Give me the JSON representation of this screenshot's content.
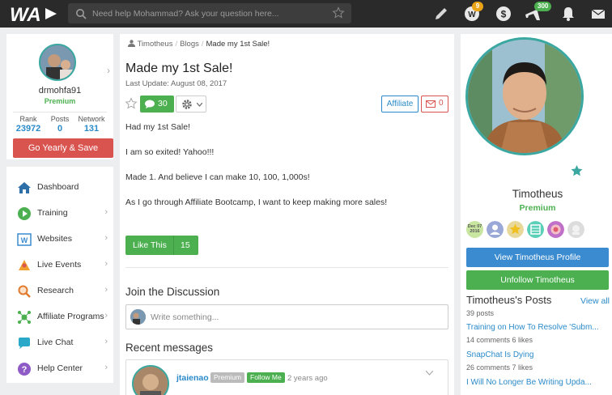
{
  "topbar": {
    "search_placeholder": "Need help Mohammad? Ask your question here...",
    "credits_badge": "9",
    "notifications_badge": "300"
  },
  "profile": {
    "username": "drmohfa91",
    "membership": "Premium",
    "stats": [
      {
        "label": "Rank",
        "value": "23972"
      },
      {
        "label": "Posts",
        "value": "0"
      },
      {
        "label": "Network",
        "value": "131"
      }
    ],
    "upgrade_label": "Go Yearly & Save"
  },
  "nav": {
    "items": [
      {
        "label": "Dashboard",
        "icon": "home-icon"
      },
      {
        "label": "Training",
        "icon": "play-icon"
      },
      {
        "label": "Websites",
        "icon": "websites-icon"
      },
      {
        "label": "Live Events",
        "icon": "live-events-icon"
      },
      {
        "label": "Research",
        "icon": "research-icon"
      },
      {
        "label": "Affiliate Programs",
        "icon": "affiliate-programs-icon"
      },
      {
        "label": "Live Chat",
        "icon": "chat-icon"
      },
      {
        "label": "Help Center",
        "icon": "help-icon"
      }
    ]
  },
  "post": {
    "breadcrumb": [
      "Timotheus",
      "Blogs",
      "Made my 1st Sale!"
    ],
    "title": "Made my 1st Sale!",
    "last_update": "Last Update: August 08, 2017",
    "comments_count": "30",
    "affiliate_label": "Affiliate",
    "mail_count": "0",
    "body": [
      "Had my 1st Sale!",
      "I am so exited! Yahoo!!!",
      "Made 1. And believe I can make 10, 100, 1,000s!",
      "As I go through Affiliate Bootcamp, I want to keep making more sales!"
    ],
    "like_label": "Like This",
    "like_count": "15"
  },
  "discussion": {
    "heading": "Join the Discussion",
    "placeholder": "Write something...",
    "recent_heading": "Recent messages",
    "messages": [
      {
        "user": "jtaienao",
        "badge": "Premium",
        "follow": "Follow Me",
        "time": "2 years ago"
      }
    ]
  },
  "author": {
    "name": "Timotheus",
    "membership": "Premium",
    "badge_date_line1": "Dec 07",
    "badge_date_line2": "2016",
    "view_profile_label": "View Timotheus Profile",
    "unfollow_label": "Unfollow Timotheus",
    "posts_heading": "Timotheus's Posts",
    "view_all_label": "View all",
    "posts_count": "39 posts",
    "posts": [
      {
        "title": "Training on How To Resolve 'Subm...",
        "meta": "14 comments   6 likes"
      },
      {
        "title": "SnapChat Is Dying",
        "meta": "26 comments   7 likes"
      },
      {
        "title": "I Will No Longer Be Writing Upda...",
        "meta": ""
      }
    ]
  },
  "colors": {
    "topbar": "#2a2a2a",
    "green": "#4cb050",
    "red": "#d9534f",
    "blue": "#3a8bd0",
    "teal_ring": "#3aa8a0"
  }
}
